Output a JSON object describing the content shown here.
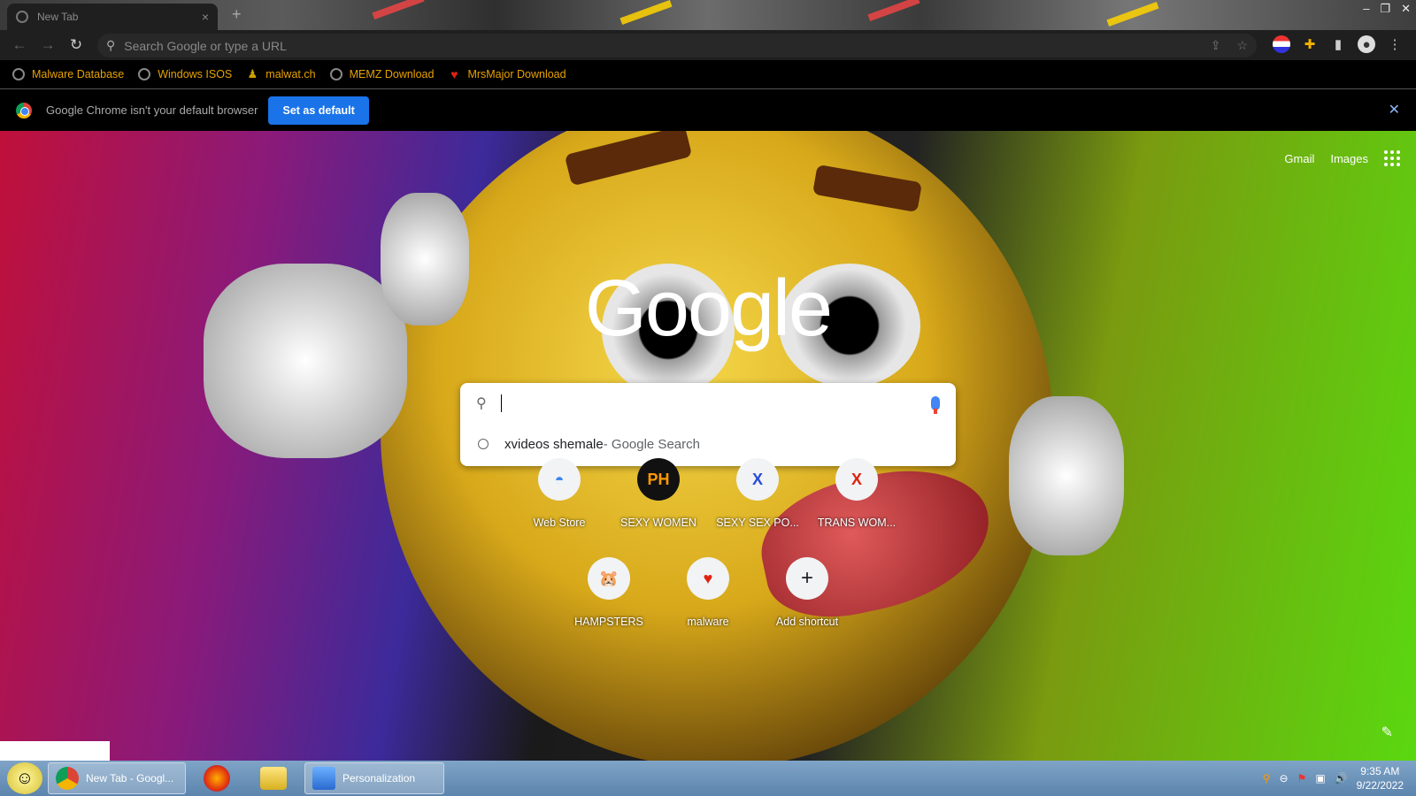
{
  "browser": {
    "tab": {
      "title": "New Tab",
      "close": "×"
    },
    "new_tab": "+",
    "window_controls": [
      "–",
      "❐",
      "✕"
    ],
    "omnibox": {
      "placeholder": "Search Google or type a URL"
    }
  },
  "bookmarks": [
    {
      "label": "Malware Database",
      "icon": "globe-icon"
    },
    {
      "label": "Windows ISOS",
      "icon": "globe-icon"
    },
    {
      "label": "malwat.ch",
      "icon": "person-icon"
    },
    {
      "label": "MEMZ Download",
      "icon": "globe-icon"
    },
    {
      "label": "MrsMajor Download",
      "icon": "heart-icon"
    }
  ],
  "infobar": {
    "message": "Google Chrome isn't your default browser",
    "button": "Set as default",
    "close": "✕"
  },
  "ntp": {
    "links": {
      "gmail": "Gmail",
      "images": "Images"
    },
    "logo": "Google",
    "search": {
      "suggestion": "xvideos shemale",
      "suggestion_suffix": " - Google Search"
    },
    "shortcuts": [
      {
        "label": "Web Store",
        "glyph": "◓",
        "color": "#4285f4"
      },
      {
        "label": "SEXY WOMEN",
        "glyph": "PH",
        "color": "#f90"
      },
      {
        "label": "SEXY SEX PO...",
        "glyph": "X",
        "color": "#2a4bd7"
      },
      {
        "label": "TRANS WOM...",
        "glyph": "X",
        "color": "#d21"
      },
      {
        "label": "HAMPSTERS",
        "glyph": "🐹",
        "color": "#333"
      },
      {
        "label": "malware",
        "glyph": "♥",
        "color": "#d21"
      },
      {
        "label": "Add shortcut",
        "glyph": "+",
        "color": "#202124"
      }
    ]
  },
  "taskbar": {
    "items": [
      {
        "label": "New Tab - Googl..."
      },
      {
        "label": "Personalization"
      }
    ],
    "clock": {
      "time": "9:35 AM",
      "date": "9/22/2022"
    }
  }
}
